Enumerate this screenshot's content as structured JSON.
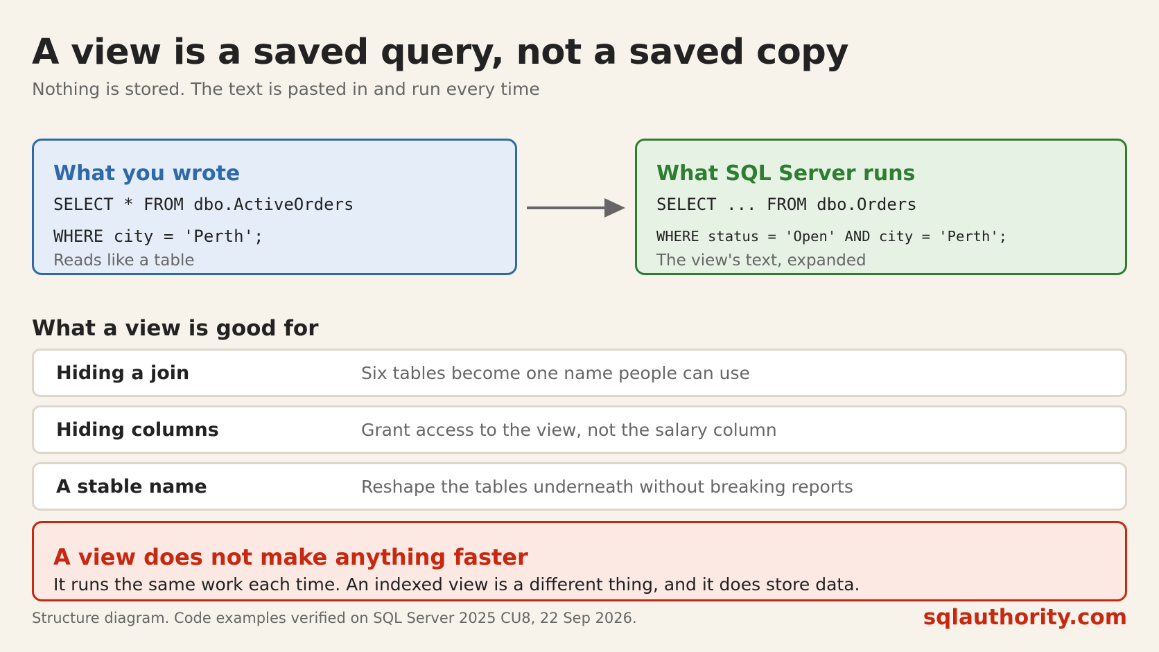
{
  "title": "A view is a saved query, not a saved copy",
  "subtitle": "Nothing is stored. The text is pasted in and run every time",
  "left_card": {
    "title": "What you wrote",
    "code_line1": "SELECT * FROM dbo.ActiveOrders",
    "code_line2": "WHERE city = 'Perth';",
    "note": "Reads like a table",
    "border_color": "#2f69a8",
    "fill_color": "#e4edf8"
  },
  "right_card": {
    "title": "What SQL Server runs",
    "code_line1": "SELECT ... FROM dbo.Orders",
    "code_line2": "WHERE status = 'Open' AND city = 'Perth';",
    "note": "The view's text, expanded",
    "border_color": "#2e7d32",
    "fill_color": "#e6f2e4"
  },
  "arrow_icon": "right-arrow-icon",
  "section_heading": "What a view is good for",
  "uses": [
    {
      "label": "Hiding a join",
      "description": "Six tables become one name people can use"
    },
    {
      "label": "Hiding columns",
      "description": "Grant access to the view, not the salary column"
    },
    {
      "label": "A stable name",
      "description": "Reshape the tables underneath without breaking reports"
    }
  ],
  "warning": {
    "title": "A view does not make anything faster",
    "text": "It runs the same work each time. An indexed view is a different thing, and it does store data.",
    "color": "#c62810"
  },
  "footer": {
    "note": "Structure diagram. Code examples verified on SQL Server 2025 CU8, 22 Sep 2026.",
    "brand": "sqlauthority.com"
  }
}
